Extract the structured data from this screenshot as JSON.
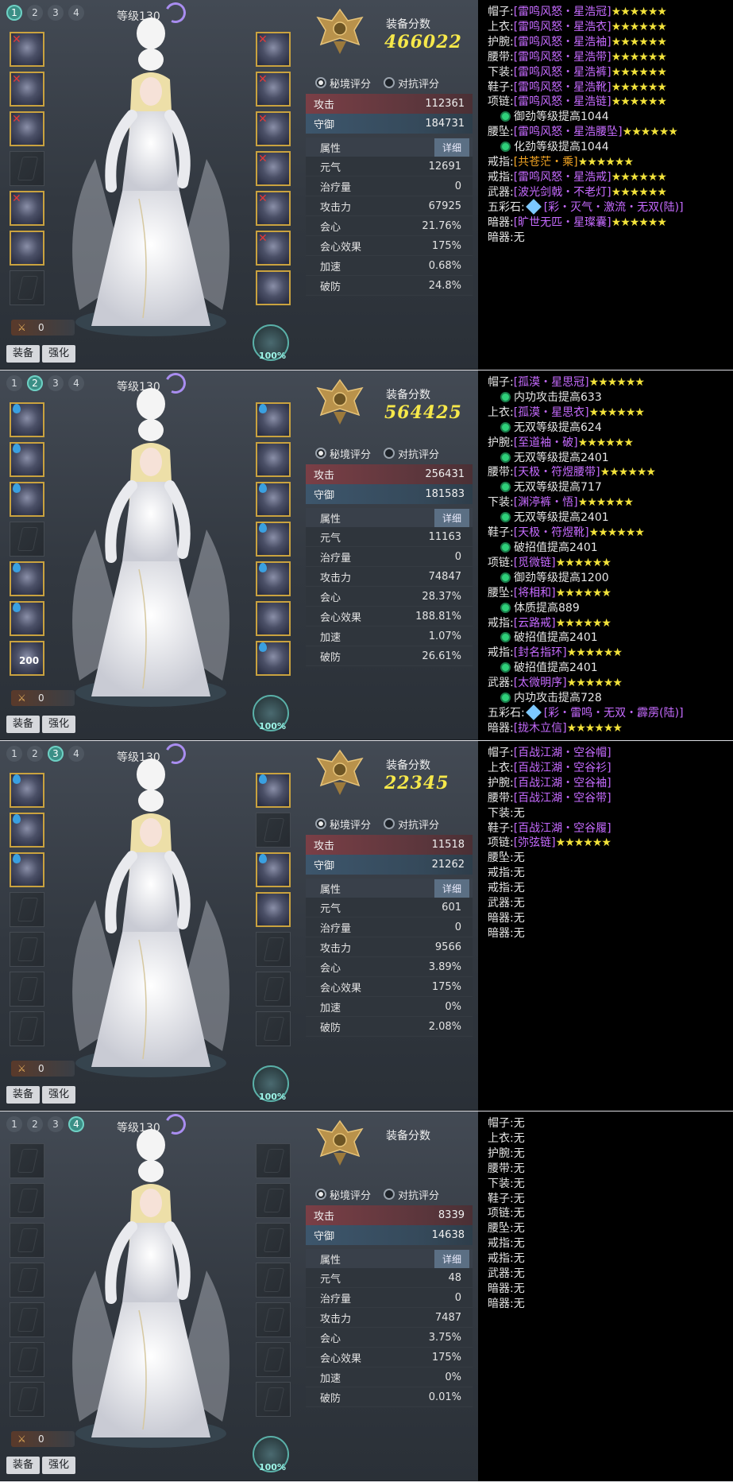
{
  "panels": [
    {
      "tabs": [
        "1",
        "2",
        "3",
        "4"
      ],
      "active_tab": 0,
      "level": "等级130",
      "score_title": "装备分数",
      "score": "466022",
      "radio1": "秘境评分",
      "radio2": "对抗评分",
      "attack_label": "攻击",
      "attack": "112361",
      "defense_label": "守御",
      "defense": "184731",
      "attr_header": "属性",
      "detail": "详细",
      "attrs": [
        {
          "k": "元气",
          "v": "12691"
        },
        {
          "k": "治疗量",
          "v": "0"
        },
        {
          "k": "攻击力",
          "v": "67925"
        },
        {
          "k": "会心",
          "v": "21.76%"
        },
        {
          "k": "会心效果",
          "v": "175%"
        },
        {
          "k": "加速",
          "v": "0.68%"
        },
        {
          "k": "破防",
          "v": "24.8%"
        }
      ],
      "lianlu": "0",
      "extra": "",
      "btn_equip": "装备",
      "btn_strengthen": "强化",
      "percent": "100%",
      "slots_left": [
        "full-x",
        "full-x",
        "full-x",
        "empty",
        "full-x",
        "full",
        "empty"
      ],
      "slots_right": [
        "full-x",
        "full-x",
        "full-x",
        "full-x",
        "full-x",
        "full-x",
        "full"
      ]
    },
    {
      "tabs": [
        "1",
        "2",
        "3",
        "4"
      ],
      "active_tab": 1,
      "level": "等级130",
      "score_title": "装备分数",
      "score": "564425",
      "radio1": "秘境评分",
      "radio2": "对抗评分",
      "attack_label": "攻击",
      "attack": "256431",
      "defense_label": "守御",
      "defense": "181583",
      "attr_header": "属性",
      "detail": "详细",
      "attrs": [
        {
          "k": "元气",
          "v": "11163"
        },
        {
          "k": "治疗量",
          "v": "0"
        },
        {
          "k": "攻击力",
          "v": "74847"
        },
        {
          "k": "会心",
          "v": "28.37%"
        },
        {
          "k": "会心效果",
          "v": "188.81%"
        },
        {
          "k": "加速",
          "v": "1.07%"
        },
        {
          "k": "破防",
          "v": "26.61%"
        }
      ],
      "lianlu": "0",
      "extra": "200",
      "btn_equip": "装备",
      "btn_strengthen": "强化",
      "percent": "100%",
      "slots_left": [
        "full-d",
        "full-d",
        "full-d",
        "empty",
        "full-d",
        "full-d",
        "full"
      ],
      "slots_right": [
        "full-d",
        "full",
        "full-d",
        "full-d",
        "full-d",
        "full",
        "full-d"
      ]
    },
    {
      "tabs": [
        "1",
        "2",
        "3",
        "4"
      ],
      "active_tab": 2,
      "level": "等级130",
      "score_title": "装备分数",
      "score": "22345",
      "radio1": "秘境评分",
      "radio2": "对抗评分",
      "attack_label": "攻击",
      "attack": "11518",
      "defense_label": "守御",
      "defense": "21262",
      "attr_header": "属性",
      "detail": "详细",
      "attrs": [
        {
          "k": "元气",
          "v": "601"
        },
        {
          "k": "治疗量",
          "v": "0"
        },
        {
          "k": "攻击力",
          "v": "9566"
        },
        {
          "k": "会心",
          "v": "3.89%"
        },
        {
          "k": "会心效果",
          "v": "175%"
        },
        {
          "k": "加速",
          "v": "0%"
        },
        {
          "k": "破防",
          "v": "2.08%"
        }
      ],
      "lianlu": "0",
      "extra": "",
      "btn_equip": "装备",
      "btn_strengthen": "强化",
      "percent": "100%",
      "slots_left": [
        "full-d",
        "full-d",
        "full-d",
        "empty",
        "empty",
        "empty",
        "empty"
      ],
      "slots_right": [
        "full-d",
        "empty",
        "full-d",
        "full",
        "empty",
        "empty",
        "empty"
      ]
    },
    {
      "tabs": [
        "1",
        "2",
        "3",
        "4"
      ],
      "active_tab": 3,
      "level": "等级130",
      "score_title": "装备分数",
      "score": "",
      "radio1": "秘境评分",
      "radio2": "对抗评分",
      "attack_label": "攻击",
      "attack": "8339",
      "defense_label": "守御",
      "defense": "14638",
      "attr_header": "属性",
      "detail": "详细",
      "attrs": [
        {
          "k": "元气",
          "v": "48"
        },
        {
          "k": "治疗量",
          "v": "0"
        },
        {
          "k": "攻击力",
          "v": "7487"
        },
        {
          "k": "会心",
          "v": "3.75%"
        },
        {
          "k": "会心效果",
          "v": "175%"
        },
        {
          "k": "加速",
          "v": "0%"
        },
        {
          "k": "破防",
          "v": "0.01%"
        }
      ],
      "lianlu": "0",
      "extra": "",
      "btn_equip": "装备",
      "btn_strengthen": "强化",
      "percent": "100%",
      "slots_left": [
        "empty",
        "empty",
        "empty",
        "empty",
        "empty",
        "empty",
        "empty"
      ],
      "slots_right": [
        "empty",
        "empty",
        "empty",
        "empty",
        "empty",
        "empty",
        "empty"
      ]
    }
  ],
  "texts": [
    {
      "lines": [
        {
          "type": "item",
          "label": "帽子:",
          "name": "[雷鸣风怒・星浩冠]",
          "stars": "★★★★★★"
        },
        {
          "type": "item",
          "label": "上衣:",
          "name": "[雷鸣风怒・星浩衣]",
          "stars": "★★★★★★"
        },
        {
          "type": "item",
          "label": "护腕:",
          "name": "[雷鸣风怒・星浩袖]",
          "stars": "★★★★★★"
        },
        {
          "type": "item",
          "label": "腰带:",
          "name": "[雷鸣风怒・星浩带]",
          "stars": "★★★★★★"
        },
        {
          "type": "item",
          "label": "下装:",
          "name": "[雷鸣风怒・星浩裤]",
          "stars": "★★★★★★"
        },
        {
          "type": "item",
          "label": "鞋子:",
          "name": "[雷鸣风怒・星浩靴]",
          "stars": "★★★★★★"
        },
        {
          "type": "item",
          "label": "项链:",
          "name": "[雷鸣风怒・星浩链]",
          "stars": "★★★★★★"
        },
        {
          "type": "sub",
          "text": "御劲等级提高1044"
        },
        {
          "type": "item",
          "label": "腰坠:",
          "name": "[雷鸣风怒・星浩腰坠]",
          "stars": "★★★★★★"
        },
        {
          "type": "sub",
          "text": "化劲等级提高1044"
        },
        {
          "type": "item",
          "label": "戒指:",
          "name": "[共苍茫・乘]",
          "stars": "★★★★★★",
          "gold": true
        },
        {
          "type": "item",
          "label": "戒指:",
          "name": "[雷鸣风怒・星浩戒]",
          "stars": "★★★★★★"
        },
        {
          "type": "item",
          "label": "武器:",
          "name": "[波光剑戟・不老灯]",
          "stars": "★★★★★★"
        },
        {
          "type": "stone",
          "label": "五彩石:",
          "name": "[彩・灭气・激流・无双(陆)]"
        },
        {
          "type": "item",
          "label": "暗器:",
          "name": "[旷世无匹・星璨囊]",
          "stars": "★★★★★★"
        },
        {
          "type": "none",
          "label": "暗器:",
          "value": "无"
        }
      ]
    },
    {
      "lines": [
        {
          "type": "item",
          "label": "帽子:",
          "name": "[孤漠・星思冠]",
          "stars": "★★★★★★"
        },
        {
          "type": "sub",
          "text": "内功攻击提高633"
        },
        {
          "type": "item",
          "label": "上衣:",
          "name": "[孤漠・星思衣]",
          "stars": "★★★★★★"
        },
        {
          "type": "sub",
          "text": "无双等级提高624"
        },
        {
          "type": "item",
          "label": "护腕:",
          "name": "[至道袖・破]",
          "stars": "★★★★★★"
        },
        {
          "type": "sub",
          "text": "无双等级提高2401"
        },
        {
          "type": "item",
          "label": "腰带:",
          "name": "[天极・符煜腰带]",
          "stars": "★★★★★★"
        },
        {
          "type": "sub",
          "text": "无双等级提高717"
        },
        {
          "type": "item",
          "label": "下装:",
          "name": "[渊渟裤・悟]",
          "stars": "★★★★★★"
        },
        {
          "type": "sub",
          "text": "无双等级提高2401"
        },
        {
          "type": "item",
          "label": "鞋子:",
          "name": "[天极・符煜靴]",
          "stars": "★★★★★★"
        },
        {
          "type": "sub",
          "text": "破招值提高2401"
        },
        {
          "type": "item",
          "label": "项链:",
          "name": "[觅微链]",
          "stars": "★★★★★★"
        },
        {
          "type": "sub",
          "text": "御劲等级提高1200"
        },
        {
          "type": "item",
          "label": "腰坠:",
          "name": "[将相和]",
          "stars": "★★★★★★"
        },
        {
          "type": "sub",
          "text": "体质提高889"
        },
        {
          "type": "item",
          "label": "戒指:",
          "name": "[云路戒]",
          "stars": "★★★★★★"
        },
        {
          "type": "sub",
          "text": "破招值提高2401"
        },
        {
          "type": "item",
          "label": "戒指:",
          "name": "[封名指环]",
          "stars": "★★★★★★"
        },
        {
          "type": "sub",
          "text": "破招值提高2401"
        },
        {
          "type": "item",
          "label": "武器:",
          "name": "[太微明序]",
          "stars": "★★★★★★"
        },
        {
          "type": "sub",
          "text": "内功攻击提高728"
        },
        {
          "type": "stone",
          "label": "五彩石:",
          "name": "[彩・雷鸣・无双・霹雳(陆)]"
        },
        {
          "type": "item",
          "label": "暗器:",
          "name": "[拢木立信]",
          "stars": "★★★★★★"
        }
      ]
    },
    {
      "lines": [
        {
          "type": "item",
          "label": "帽子:",
          "name": "[百战江湖・空谷帽]",
          "stars": ""
        },
        {
          "type": "item",
          "label": "上衣:",
          "name": "[百战江湖・空谷衫]",
          "stars": ""
        },
        {
          "type": "item",
          "label": "护腕:",
          "name": "[百战江湖・空谷袖]",
          "stars": ""
        },
        {
          "type": "item",
          "label": "腰带:",
          "name": "[百战江湖・空谷带]",
          "stars": ""
        },
        {
          "type": "none",
          "label": "下装:",
          "value": "无"
        },
        {
          "type": "item",
          "label": "鞋子:",
          "name": "[百战江湖・空谷履]",
          "stars": ""
        },
        {
          "type": "item",
          "label": "项链:",
          "name": "[弥弦链]",
          "stars": "★★★★★★"
        },
        {
          "type": "none",
          "label": "腰坠:",
          "value": "无"
        },
        {
          "type": "none",
          "label": "戒指:",
          "value": "无"
        },
        {
          "type": "none",
          "label": "戒指:",
          "value": "无"
        },
        {
          "type": "none",
          "label": "武器:",
          "value": "无"
        },
        {
          "type": "none",
          "label": "暗器:",
          "value": "无"
        },
        {
          "type": "none",
          "label": "暗器:",
          "value": "无"
        }
      ]
    },
    {
      "lines": [
        {
          "type": "none",
          "label": "帽子:",
          "value": "无"
        },
        {
          "type": "none",
          "label": "上衣:",
          "value": "无"
        },
        {
          "type": "none",
          "label": "护腕:",
          "value": "无"
        },
        {
          "type": "none",
          "label": "腰带:",
          "value": "无"
        },
        {
          "type": "none",
          "label": "下装:",
          "value": "无"
        },
        {
          "type": "none",
          "label": "鞋子:",
          "value": "无"
        },
        {
          "type": "none",
          "label": "项链:",
          "value": "无"
        },
        {
          "type": "none",
          "label": "腰坠:",
          "value": "无"
        },
        {
          "type": "none",
          "label": "戒指:",
          "value": "无"
        },
        {
          "type": "none",
          "label": "戒指:",
          "value": "无"
        },
        {
          "type": "none",
          "label": "武器:",
          "value": "无"
        },
        {
          "type": "none",
          "label": "暗器:",
          "value": "无"
        },
        {
          "type": "none",
          "label": "暗器:",
          "value": "无"
        }
      ]
    }
  ]
}
